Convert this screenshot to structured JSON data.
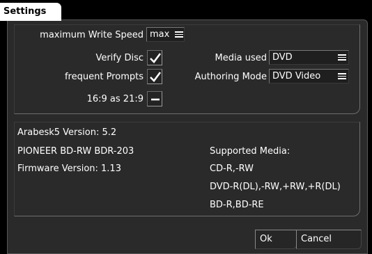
{
  "window": {
    "tab_title": "Settings"
  },
  "settings": {
    "write_speed_label": "maximum Write Speed",
    "write_speed_value": "max",
    "verify_label": "Verify Disc",
    "verify_checked": true,
    "prompts_label": "frequent Prompts",
    "prompts_checked": true,
    "aspect_label": "16:9 as 21:9",
    "aspect_checked": false,
    "media_label": "Media used",
    "media_value": "DVD",
    "authoring_label": "Authoring Mode",
    "authoring_value": "DVD Video"
  },
  "info": {
    "version": "Arabesk5 Version: 5.2",
    "drive": "PIONEER BD-RW   BDR-203",
    "firmware": "Firmware Version: 1.13",
    "supported_title": "Supported Media:",
    "media_lines": [
      "CD-R,-RW",
      "DVD-R(DL),-RW,+RW,+R(DL)",
      "BD-R,BD-RE"
    ]
  },
  "buttons": {
    "ok": "Ok",
    "cancel": "Cancel"
  },
  "icons": {
    "checked": "checkmark-icon",
    "unchecked": "dash-icon",
    "dropdown": "hamburger-menu-icon"
  }
}
